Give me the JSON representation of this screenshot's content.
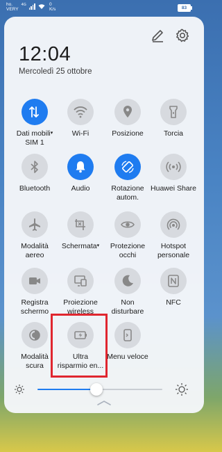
{
  "status_bar": {
    "carrier_top": "ho.",
    "carrier_bottom": "VERY",
    "network_type": "4G",
    "speed_value": "0",
    "speed_unit": "K/s",
    "battery": "83"
  },
  "panel": {
    "time": "12:04",
    "date": "Mercoledì 25 ottobre"
  },
  "colors": {
    "accent": "#1f7cf0",
    "tile_off": "#d7dadf",
    "highlight": "#e0262f"
  },
  "tiles": [
    {
      "label": "Dati mobili",
      "label2": "SIM 1",
      "icon": "mobile-data-icon",
      "on": true,
      "dropdown": true
    },
    {
      "label": "Wi-Fi",
      "icon": "wifi-icon",
      "on": false
    },
    {
      "label": "Posizione",
      "icon": "location-icon",
      "on": false
    },
    {
      "label": "Torcia",
      "icon": "flashlight-icon",
      "on": false
    },
    {
      "label": "Bluetooth",
      "icon": "bluetooth-icon",
      "on": false
    },
    {
      "label": "Audio",
      "icon": "bell-icon",
      "on": true
    },
    {
      "label": "Rotazione",
      "label2": "autom.",
      "icon": "auto-rotate-icon",
      "on": true
    },
    {
      "label": "Huawei Share",
      "icon": "huawei-share-icon",
      "on": false
    },
    {
      "label": "Modalità",
      "label2": "aereo",
      "icon": "airplane-icon",
      "on": false
    },
    {
      "label": "Schermata",
      "icon": "screenshot-icon",
      "on": false,
      "dropdown": true
    },
    {
      "label": "Protezione",
      "label2": "occhi",
      "icon": "eye-icon",
      "on": false
    },
    {
      "label": "Hotspot",
      "label2": "personale",
      "icon": "hotspot-icon",
      "on": false
    },
    {
      "label": "Registra",
      "label2": "schermo",
      "icon": "screen-record-icon",
      "on": false
    },
    {
      "label": "Proiezione",
      "label2": "wireless",
      "icon": "wireless-projection-icon",
      "on": false
    },
    {
      "label": "Non",
      "label2": "disturbare",
      "icon": "moon-icon",
      "on": false
    },
    {
      "label": "NFC",
      "icon": "nfc-icon",
      "on": false
    },
    {
      "label": "Modalità",
      "label2": "scura",
      "icon": "dark-mode-icon",
      "on": false
    },
    {
      "label": "Ultra",
      "label2": "risparmio en...",
      "icon": "battery-saver-icon",
      "on": false
    },
    {
      "label": "Menu veloce",
      "icon": "quick-menu-icon",
      "on": false
    }
  ],
  "brightness": {
    "level": 0.47
  }
}
